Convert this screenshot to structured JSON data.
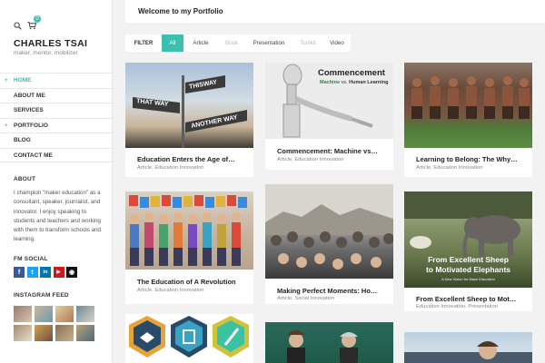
{
  "sidebar": {
    "cart_count": "0",
    "site_title": "CHARLES TSAI",
    "tagline": "maker, mentor, mobilizer",
    "nav": [
      {
        "label": "HOME",
        "active": true,
        "bullet": "+"
      },
      {
        "label": "ABOUT ME",
        "active": false,
        "bullet": ""
      },
      {
        "label": "SERVICES",
        "active": false,
        "bullet": ""
      },
      {
        "label": "PORTFOLIO",
        "active": false,
        "bullet": "+"
      },
      {
        "label": "BLOG",
        "active": false,
        "bullet": ""
      },
      {
        "label": "CONTACT ME",
        "active": false,
        "bullet": ""
      }
    ],
    "about_title": "ABOUT",
    "about_text": "I champion \"maker education\" as a consultant, speaker, journalist, and innovator. I enjoy speaking to students and teachers and working with them to transform schools and learning.",
    "social_title": "FM SOCIAL",
    "social": [
      {
        "icon": "facebook-icon",
        "glyph": "f",
        "color": "#3b5998"
      },
      {
        "icon": "twitter-icon",
        "glyph": "t",
        "color": "#1da1f2"
      },
      {
        "icon": "linkedin-icon",
        "glyph": "in",
        "color": "#0077b5"
      },
      {
        "icon": "youtube-icon",
        "glyph": "▶",
        "color": "#cc181e"
      },
      {
        "icon": "rss-icon",
        "glyph": "◉",
        "color": "#111111"
      }
    ],
    "instagram_title": "INSTAGRAM FEED",
    "instagram_colors": [
      "#9a7b6a",
      "#c8b89a",
      "#b07a5a",
      "#a68c6e",
      "#6d8a9a",
      "#c9a45c",
      "#8a6e5a",
      "#b9a27a"
    ]
  },
  "header": {
    "title": "Welcome to my Portfolio"
  },
  "filter": {
    "label": "FILTER",
    "buttons": [
      {
        "label": "All",
        "state": "active"
      },
      {
        "label": "Article",
        "state": "normal"
      },
      {
        "label": "Book",
        "state": "dim"
      },
      {
        "label": "Presentation",
        "state": "normal"
      },
      {
        "label": "Toolkit",
        "state": "dim"
      },
      {
        "label": "Video",
        "state": "normal"
      }
    ]
  },
  "cards": [
    {
      "title": "Education Enters the Age of…",
      "category": "Article, Education Innovation",
      "image_text": [
        "THAT WAY",
        "THISWAY",
        "ANOTHER WAY"
      ]
    },
    {
      "title": "Commencement: Machine vs…",
      "category": "Article, Education Innovation",
      "image_text": [
        "Commencement",
        "Machine",
        "vs.",
        "Human Learning"
      ]
    },
    {
      "title": "Learning to Belong: The Why…",
      "category": "Article, Education Innovation",
      "image_text": []
    },
    {
      "title": "The Education of A Revolution",
      "category": "Article, Education Innovation",
      "image_text": []
    },
    {
      "title": "Making Perfect Moments: Ho…",
      "category": "Article, Social Innovation",
      "image_text": []
    },
    {
      "title": "From Excellent Sheep to Mot…",
      "category": "Education Innovation, Presentation",
      "image_text": [
        "From Excellent Sheep",
        "to Motivated Elephants",
        "A New Vision for Mass Education"
      ]
    },
    {
      "title": "",
      "category": "",
      "image_text": []
    },
    {
      "title": "",
      "category": "",
      "image_text": []
    },
    {
      "title": "",
      "category": "",
      "image_text": []
    }
  ],
  "colors": {
    "accent": "#3cbfae"
  }
}
